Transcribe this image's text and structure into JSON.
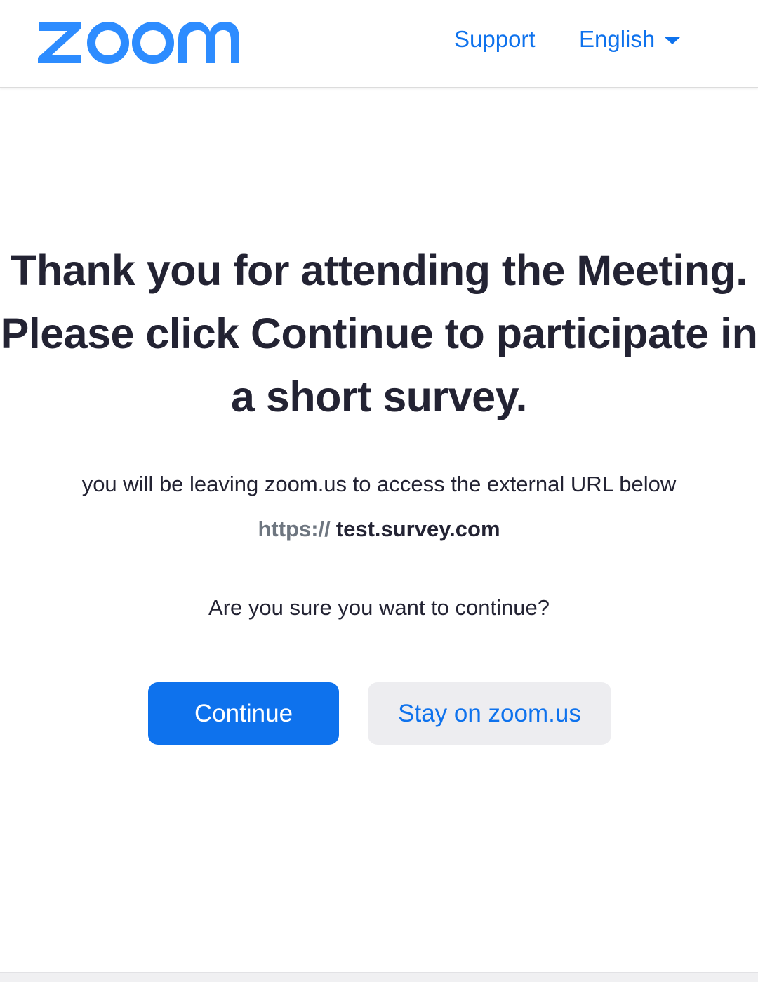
{
  "header": {
    "logo_text": "zoom",
    "support_label": "Support",
    "language_label": "English"
  },
  "main": {
    "headline_line1": "Thank you for attending the Meeting.",
    "headline_line2": "Please click Continue to participate in",
    "headline_line3": "a short survey.",
    "notice": "you will be leaving zoom.us to access the external URL below",
    "url_scheme": "https://",
    "url_host": "test.survey.com",
    "confirm": "Are you sure you want to continue?",
    "continue_label": "Continue",
    "stay_label": "Stay on zoom.us"
  },
  "colors": {
    "brand": "#0e72ed",
    "text": "#232333",
    "secondary_button_bg": "#ededf0"
  }
}
